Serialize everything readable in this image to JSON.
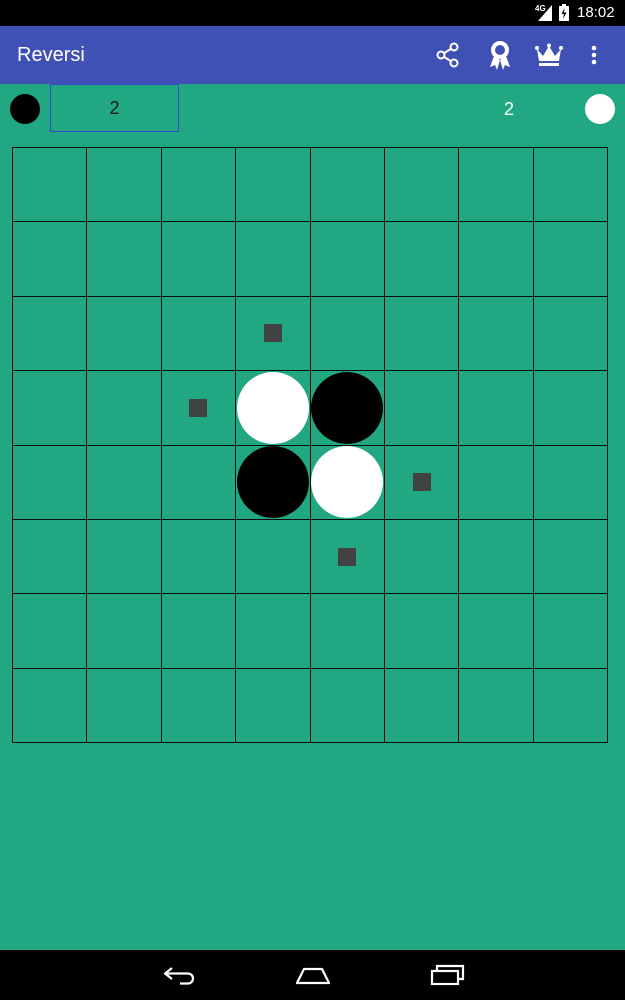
{
  "status_bar": {
    "network": "4G",
    "time": "18:02",
    "icons": [
      "signal-icon",
      "battery-icon"
    ]
  },
  "app_bar": {
    "title": "Reversi",
    "actions": [
      "share-icon",
      "achievements-icon",
      "leaderboard-crown-icon",
      "overflow-menu-icon"
    ]
  },
  "scores": {
    "black": "2",
    "white": "2",
    "active_player": "black"
  },
  "board": {
    "size": 8,
    "pieces": [
      {
        "row": 3,
        "col": 3,
        "color": "white"
      },
      {
        "row": 3,
        "col": 4,
        "color": "black"
      },
      {
        "row": 4,
        "col": 3,
        "color": "black"
      },
      {
        "row": 4,
        "col": 4,
        "color": "white"
      }
    ],
    "valid_moves": [
      {
        "row": 2,
        "col": 3
      },
      {
        "row": 3,
        "col": 2
      },
      {
        "row": 4,
        "col": 5
      },
      {
        "row": 5,
        "col": 4
      }
    ]
  },
  "nav_bar": {
    "buttons": [
      "back-icon",
      "home-icon",
      "recents-icon"
    ]
  },
  "colors": {
    "background": "#21a883",
    "app_bar": "#3f51b5",
    "black_disc": "#000000",
    "white_disc": "#ffffff",
    "hint_marker": "#424242",
    "grid_line": "#0d0d0d",
    "score_box_border": "#2f49c9"
  }
}
